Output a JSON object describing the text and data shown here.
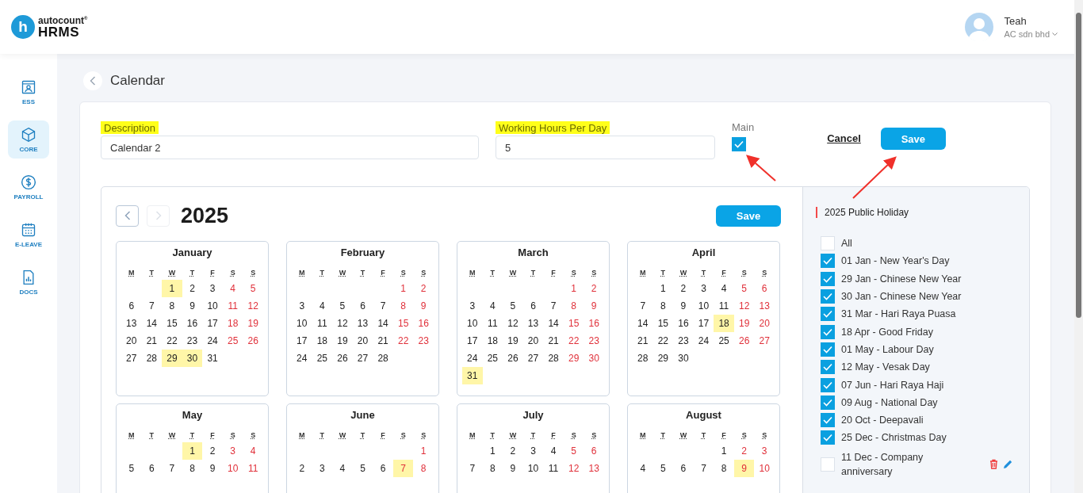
{
  "logo": {
    "mark": "h",
    "brand": "autocount$^{®}$",
    "product": "HRMS"
  },
  "user": {
    "name": "Teah",
    "company": "AC sdn bhd"
  },
  "sidebar": {
    "items": [
      {
        "label": "ESS",
        "selected": false
      },
      {
        "label": "CORE",
        "selected": true
      },
      {
        "label": "PAYROLL",
        "selected": false
      },
      {
        "label": "E-LEAVE",
        "selected": false
      },
      {
        "label": "DOCS",
        "selected": false
      }
    ]
  },
  "page_title": "Calendar",
  "form": {
    "description": {
      "label": "Description",
      "value": "Calendar 2"
    },
    "hours": {
      "label": "Working Hours Per Day",
      "value": "5"
    },
    "main": {
      "label": "Main",
      "checked": true
    },
    "cancel": "Cancel",
    "save": "Save"
  },
  "calendar": {
    "year": "2025",
    "prev_disabled": false,
    "next_disabled": true,
    "save": "Save",
    "months": [
      {
        "name": "January",
        "weekdays": [
          "M",
          "T",
          "W",
          "T",
          "F",
          "S",
          "S"
        ],
        "weeks": [
          [
            {
              "day": "1",
              "holiday": true
            },
            "2",
            "3",
            "4",
            "5"
          ],
          [
            "6",
            "7",
            "8",
            "9",
            "10",
            "11",
            "12"
          ],
          [
            "13",
            "14",
            "15",
            "16",
            "17",
            "18",
            "19"
          ],
          [
            "20",
            "21",
            "22",
            "23",
            "24",
            "25",
            "26"
          ],
          [
            "27",
            "28",
            {
              "day": "29",
              "holiday": true
            },
            {
              "day": "30",
              "holiday": true
            },
            "31"
          ]
        ]
      },
      {
        "name": "February",
        "weekdays": [
          "M",
          "T",
          "W",
          "T",
          "F",
          "S",
          "S"
        ],
        "weeks": [
          [
            "1",
            "2"
          ],
          [
            "3",
            "4",
            "5",
            "6",
            "7",
            "8",
            "9"
          ],
          [
            "10",
            "11",
            "12",
            "13",
            "14",
            "15",
            "16"
          ],
          [
            "17",
            "18",
            "19",
            "20",
            "21",
            "22",
            "23"
          ],
          [
            "24",
            "25",
            "26",
            "27",
            "28"
          ]
        ]
      },
      {
        "name": "March",
        "weekdays": [
          "M",
          "T",
          "W",
          "T",
          "F",
          "S",
          "S"
        ],
        "weeks": [
          [
            "1",
            "2"
          ],
          [
            "3",
            "4",
            "5",
            "6",
            "7",
            "8",
            "9"
          ],
          [
            "10",
            "11",
            "12",
            "13",
            "14",
            "15",
            "16"
          ],
          [
            "17",
            "18",
            "19",
            "20",
            "21",
            "22",
            "23"
          ],
          [
            "24",
            "25",
            "26",
            "27",
            "28",
            "29",
            "30"
          ],
          [
            {
              "day": "31",
              "holiday": true
            }
          ]
        ]
      },
      {
        "name": "April",
        "weekdays": [
          "M",
          "T",
          "W",
          "T",
          "F",
          "S",
          "S"
        ],
        "weeks": [
          [
            "1",
            "2",
            "3",
            "4",
            "5",
            "6"
          ],
          [
            "7",
            "8",
            "9",
            "10",
            "11",
            "12",
            "13"
          ],
          [
            "14",
            "15",
            "16",
            "17",
            {
              "day": "18",
              "holiday": true
            },
            "19",
            "20"
          ],
          [
            "21",
            "22",
            "23",
            "24",
            "25",
            "26",
            "27"
          ],
          [
            "28",
            "29",
            "30"
          ]
        ]
      },
      {
        "name": "May",
        "weekdays": [
          "M",
          "T",
          "W",
          "T",
          "F",
          "S",
          "S"
        ],
        "weeks": [
          [
            {
              "day": "1",
              "holiday": true
            },
            "2",
            "3",
            "4"
          ],
          [
            "5",
            "6",
            "7",
            "8",
            "9",
            "10",
            "11"
          ]
        ]
      },
      {
        "name": "June",
        "weekdays": [
          "M",
          "T",
          "W",
          "T",
          "F",
          "S",
          "S"
        ],
        "weeks": [
          [
            "1"
          ],
          [
            "2",
            "3",
            "4",
            "5",
            "6",
            {
              "day": "7",
              "holiday": true
            },
            "8"
          ]
        ]
      },
      {
        "name": "July",
        "weekdays": [
          "M",
          "T",
          "W",
          "T",
          "F",
          "S",
          "S"
        ],
        "weeks": [
          [
            "1",
            "2",
            "3",
            "4",
            "5",
            "6"
          ],
          [
            "7",
            "8",
            "9",
            "10",
            "11",
            "12",
            "13"
          ]
        ]
      },
      {
        "name": "August",
        "weekdays": [
          "M",
          "T",
          "W",
          "T",
          "F",
          "S",
          "S"
        ],
        "weeks": [
          [
            "1",
            "2",
            "3"
          ],
          [
            "4",
            "5",
            "6",
            "7",
            "8",
            {
              "day": "9",
              "holiday": true
            },
            "10"
          ]
        ]
      }
    ]
  },
  "holidays": {
    "title": "2025 Public Holiday",
    "all": {
      "label": "All",
      "checked": false
    },
    "items": [
      {
        "label": "01 Jan - New Year's Day",
        "checked": true,
        "custom": false
      },
      {
        "label": "29 Jan - Chinese New Year",
        "checked": true,
        "custom": false
      },
      {
        "label": "30 Jan - Chinese New Year",
        "checked": true,
        "custom": false
      },
      {
        "label": "31 Mar - Hari Raya Puasa",
        "checked": true,
        "custom": false
      },
      {
        "label": "18 Apr - Good Friday",
        "checked": true,
        "custom": false
      },
      {
        "label": "01 May - Labour Day",
        "checked": true,
        "custom": false
      },
      {
        "label": "12 May - Vesak Day",
        "checked": true,
        "custom": false
      },
      {
        "label": "07 Jun - Hari Raya Haji",
        "checked": true,
        "custom": false
      },
      {
        "label": "09 Aug - National Day",
        "checked": true,
        "custom": false
      },
      {
        "label": "20 Oct - Deepavali",
        "checked": true,
        "custom": false
      },
      {
        "label": "25 Dec - Christmas Day",
        "checked": true,
        "custom": false
      },
      {
        "label": "11 Dec - Company anniversary",
        "checked": false,
        "custom": true
      }
    ]
  }
}
